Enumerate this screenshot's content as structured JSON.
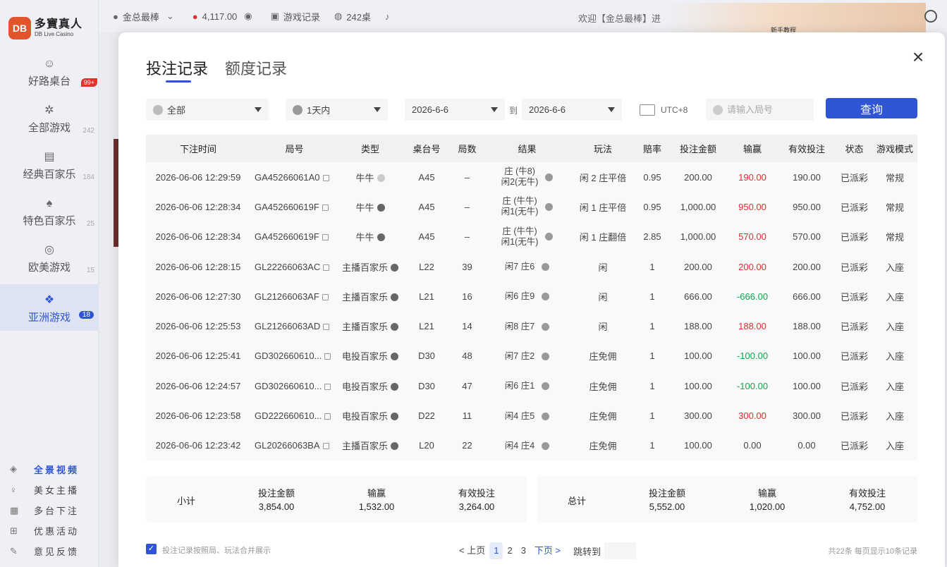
{
  "brand": {
    "badge": "DB",
    "name_cn": "多寶真人",
    "name_en": "DB Live Casino"
  },
  "sidebar": {
    "items": [
      {
        "label": "好路桌台",
        "count": "99+",
        "icon": "road-icon"
      },
      {
        "label": "全部游戏",
        "count": "242",
        "icon": "all-games-icon"
      },
      {
        "label": "经典百家乐",
        "count": "184",
        "icon": "baccarat-icon"
      },
      {
        "label": "特色百家乐",
        "count": "25",
        "icon": "cards-icon"
      },
      {
        "label": "欧美游戏",
        "count": "15",
        "icon": "roulette-icon"
      },
      {
        "label": "亚洲游戏",
        "count": "18",
        "icon": "asia-icon"
      }
    ],
    "links": [
      {
        "label": "全景视频",
        "icon": "panorama-icon"
      },
      {
        "label": "美女主播",
        "icon": "mic-icon"
      },
      {
        "label": "多台下注",
        "icon": "multi-table-icon"
      },
      {
        "label": "优惠活动",
        "icon": "gift-icon"
      },
      {
        "label": "意见反馈",
        "icon": "feedback-icon"
      }
    ]
  },
  "topbar": {
    "username": "金总最棒",
    "balance": "4,117.00",
    "game_records": "游戏记录",
    "tables": "242桌",
    "welcome": "欢迎【金总最棒】进",
    "banner_text": "新手教程"
  },
  "modal": {
    "tabs": [
      "投注记录",
      "额度记录"
    ],
    "filters": {
      "game": "全部",
      "period": "1天内",
      "date_from": "2026-6-6",
      "to": "到",
      "date_to": "2026-6-6",
      "timezone": "UTC+8",
      "round_placeholder": "请输入局号",
      "query": "查询"
    },
    "columns": [
      "下注时间",
      "局号",
      "类型",
      "桌台号",
      "局数",
      "结果",
      "玩法",
      "赔率",
      "投注金额",
      "输赢",
      "有效投注",
      "状态",
      "游戏模式"
    ],
    "rows": [
      {
        "time": "2026-06-06 12:29:59",
        "round": "GA45266061A0",
        "type": "牛牛",
        "table": "A45",
        "num": "–",
        "result1": "庄 (牛8)",
        "result2": "闲2(无牛)",
        "play": "闲 2 庄平倍",
        "odds": "0.95",
        "bet": "200.00",
        "win": "190.00",
        "win_color": "red",
        "valid": "190.00",
        "status": "已派彩",
        "mode": "常规",
        "play_light": true
      },
      {
        "time": "2026-06-06 12:28:34",
        "round": "GA452660619F",
        "type": "牛牛",
        "table": "A45",
        "num": "–",
        "result1": "庄 (牛牛)",
        "result2": "闲1(无牛)",
        "play": "闲 1 庄平倍",
        "odds": "0.95",
        "bet": "1,000.00",
        "win": "950.00",
        "win_color": "red",
        "valid": "950.00",
        "status": "已派彩",
        "mode": "常规"
      },
      {
        "time": "2026-06-06 12:28:34",
        "round": "GA452660619F",
        "type": "牛牛",
        "table": "A45",
        "num": "–",
        "result1": "庄 (牛牛)",
        "result2": "闲1(无牛)",
        "play": "闲 1 庄翻倍",
        "odds": "2.85",
        "bet": "1,000.00",
        "win": "570.00",
        "win_color": "red",
        "valid": "570.00",
        "status": "已派彩",
        "mode": "常规"
      },
      {
        "time": "2026-06-06 12:28:15",
        "round": "GL22266063AC",
        "type": "主播百家乐",
        "table": "L22",
        "num": "39",
        "result1": "闲7 庄6",
        "result2": "",
        "play": "闲",
        "odds": "1",
        "bet": "200.00",
        "win": "200.00",
        "win_color": "red",
        "valid": "200.00",
        "status": "已派彩",
        "mode": "入座"
      },
      {
        "time": "2026-06-06 12:27:30",
        "round": "GL21266063AF",
        "type": "主播百家乐",
        "table": "L21",
        "num": "16",
        "result1": "闲6 庄9",
        "result2": "",
        "play": "闲",
        "odds": "1",
        "bet": "666.00",
        "win": "-666.00",
        "win_color": "green",
        "valid": "666.00",
        "status": "已派彩",
        "mode": "入座"
      },
      {
        "time": "2026-06-06 12:25:53",
        "round": "GL21266063AD",
        "type": "主播百家乐",
        "table": "L21",
        "num": "14",
        "result1": "闲8 庄7",
        "result2": "",
        "play": "闲",
        "odds": "1",
        "bet": "188.00",
        "win": "188.00",
        "win_color": "red",
        "valid": "188.00",
        "status": "已派彩",
        "mode": "入座"
      },
      {
        "time": "2026-06-06 12:25:41",
        "round": "GD302660610...",
        "type": "电投百家乐",
        "table": "D30",
        "num": "48",
        "result1": "闲7 庄2",
        "result2": "",
        "play": "庄免佣",
        "odds": "1",
        "bet": "100.00",
        "win": "-100.00",
        "win_color": "green",
        "valid": "100.00",
        "status": "已派彩",
        "mode": "入座"
      },
      {
        "time": "2026-06-06 12:24:57",
        "round": "GD302660610...",
        "type": "电投百家乐",
        "table": "D30",
        "num": "47",
        "result1": "闲6 庄1",
        "result2": "",
        "play": "庄免佣",
        "odds": "1",
        "bet": "100.00",
        "win": "-100.00",
        "win_color": "green",
        "valid": "100.00",
        "status": "已派彩",
        "mode": "入座"
      },
      {
        "time": "2026-06-06 12:23:58",
        "round": "GD222660610...",
        "type": "电投百家乐",
        "table": "D22",
        "num": "11",
        "result1": "闲4 庄5",
        "result2": "",
        "play": "庄免佣",
        "odds": "1",
        "bet": "300.00",
        "win": "300.00",
        "win_color": "red",
        "valid": "300.00",
        "status": "已派彩",
        "mode": "入座"
      },
      {
        "time": "2026-06-06 12:23:42",
        "round": "GL20266063BA",
        "type": "主播百家乐",
        "table": "L20",
        "num": "22",
        "result1": "闲4 庄4",
        "result2": "",
        "play": "庄免佣",
        "odds": "1",
        "bet": "100.00",
        "win": "0.00",
        "win_color": "normal",
        "valid": "0.00",
        "status": "已派彩",
        "mode": "入座"
      }
    ],
    "subtotal": {
      "title": "小计",
      "bet_label": "投注金额",
      "bet": "3,854.00",
      "win_label": "输赢",
      "win": "1,532.00",
      "valid_label": "有效投注",
      "valid": "3,264.00"
    },
    "total": {
      "title": "总计",
      "bet_label": "投注金额",
      "bet": "5,552.00",
      "win_label": "输赢",
      "win": "1,020.00",
      "valid_label": "有效投注",
      "valid": "4,752.00"
    },
    "footer": {
      "merge_label": "投注记录按照局、玩法合并展示",
      "prev": "< 上页",
      "pages": [
        "1",
        "2",
        "3"
      ],
      "next": "下页 >",
      "jump": "跳转到",
      "count_info": "共22条   每页显示10条记录"
    }
  },
  "colors": {
    "accent": "#2f55d4",
    "win": "#e02d2d",
    "loss": "#10a646",
    "hot": "#e3322c",
    "brand": "#e2542c"
  }
}
